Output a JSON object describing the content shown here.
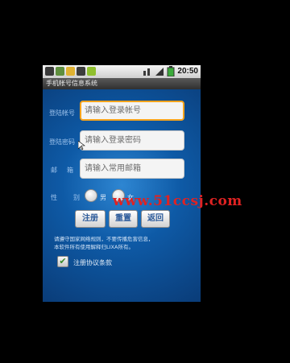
{
  "status_bar": {
    "clock": "20:50",
    "icons": [
      "usb-icon",
      "download-icon",
      "sms-icon",
      "debug-icon",
      "market-icon",
      "network-icon",
      "signal-icon",
      "battery-icon"
    ]
  },
  "title_bar": {
    "title": "手机帐号信息系统"
  },
  "form": {
    "account_label": "登陆帐号",
    "account_placeholder": "请输入登录帐号",
    "password_label": "登陆密码",
    "password_placeholder": "请输入登录密码",
    "email_label_1": "邮",
    "email_label_2": "箱",
    "email_placeholder": "请输入常用邮箱",
    "gender_label_1": "性",
    "gender_label_2": "别",
    "gender_male": "男",
    "gender_female": "女"
  },
  "buttons": {
    "register": "注册",
    "reset": "重置",
    "back": "返回"
  },
  "notes": {
    "line1": "请遵守国家网络规则，不要传播危害信息，",
    "line2": "本软件所有使用解释归LIXA所有。"
  },
  "agreement": {
    "label": "注册协议条款",
    "checked": true
  },
  "watermark": {
    "text": "www.51ccsj.com"
  },
  "colors": {
    "focus_border": "#f6a31c",
    "watermark": "#e02222",
    "background": "#0e5aa6"
  }
}
